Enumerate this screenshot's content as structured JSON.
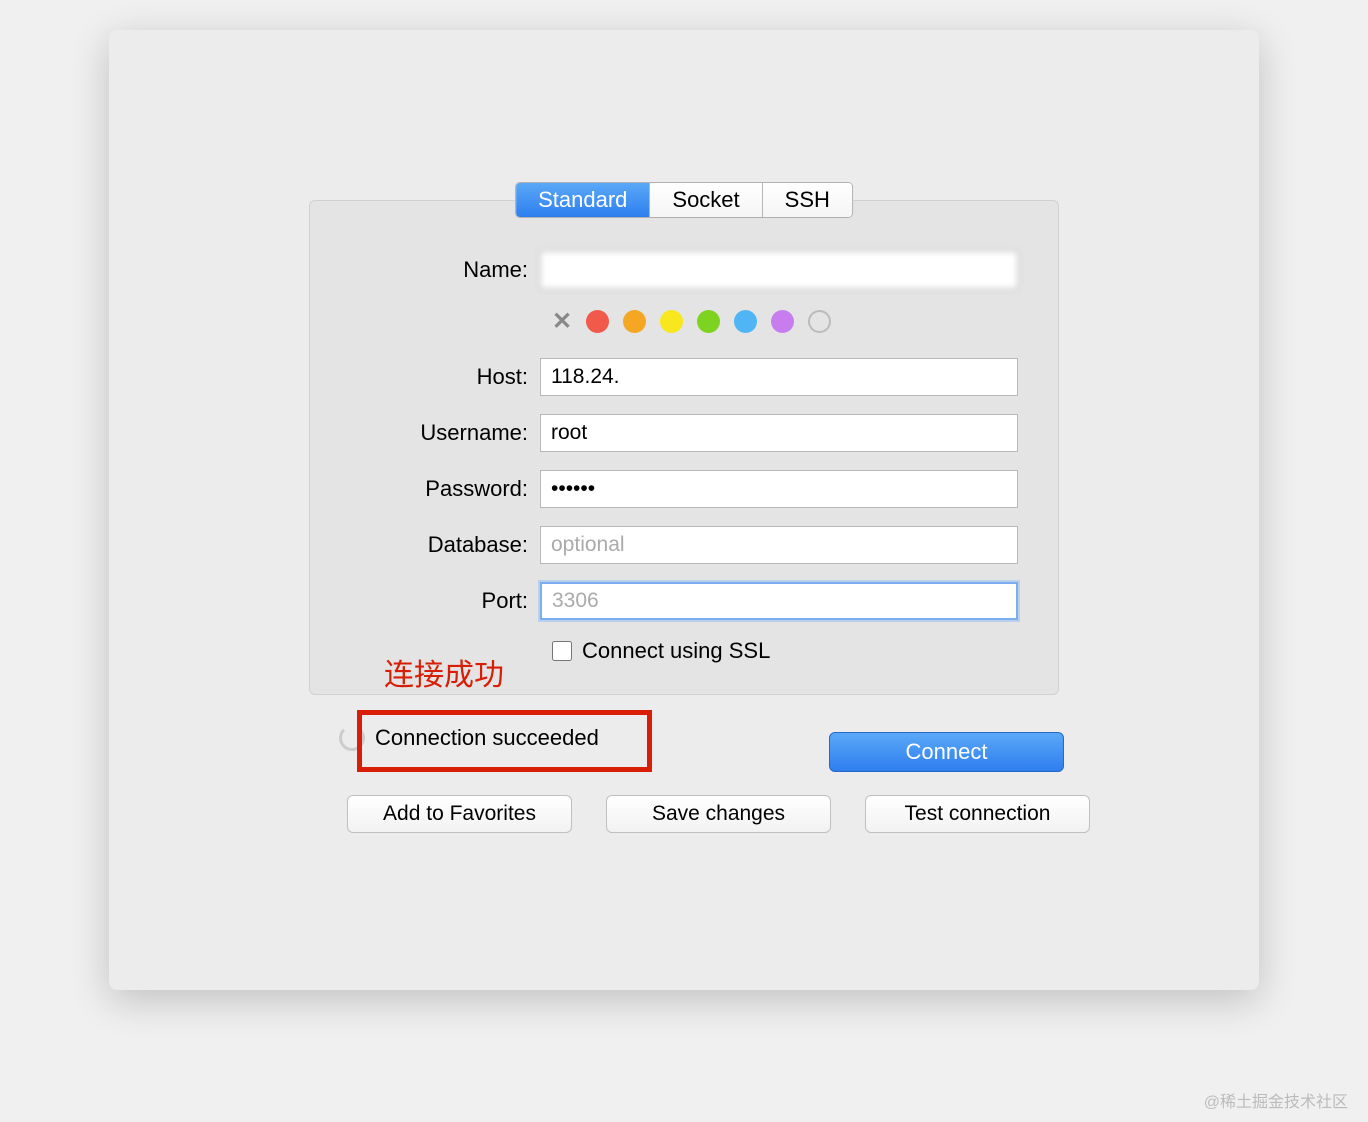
{
  "tabs": {
    "standard": "Standard",
    "socket": "Socket",
    "ssh": "SSH"
  },
  "labels": {
    "name": "Name:",
    "host": "Host:",
    "username": "Username:",
    "password": "Password:",
    "database": "Database:",
    "port": "Port:",
    "ssl": "Connect using SSL"
  },
  "values": {
    "name": "",
    "host": "118.24.",
    "username": "root",
    "password": "••••••",
    "database": "",
    "port": ""
  },
  "placeholders": {
    "database": "optional",
    "port": "3306"
  },
  "colors": {
    "red": "#f15a4a",
    "orange": "#f5a623",
    "yellow": "#f8e71c",
    "green": "#7ed321",
    "blue": "#50b5f5",
    "purple": "#c77ded",
    "gray": "#bbbbbb"
  },
  "annotation": "连接成功",
  "status": {
    "text": "Connection succeeded"
  },
  "buttons": {
    "connect": "Connect",
    "add_favorites": "Add to Favorites",
    "save_changes": "Save changes",
    "test_connection": "Test connection"
  },
  "watermark": "@稀土掘金技术社区"
}
